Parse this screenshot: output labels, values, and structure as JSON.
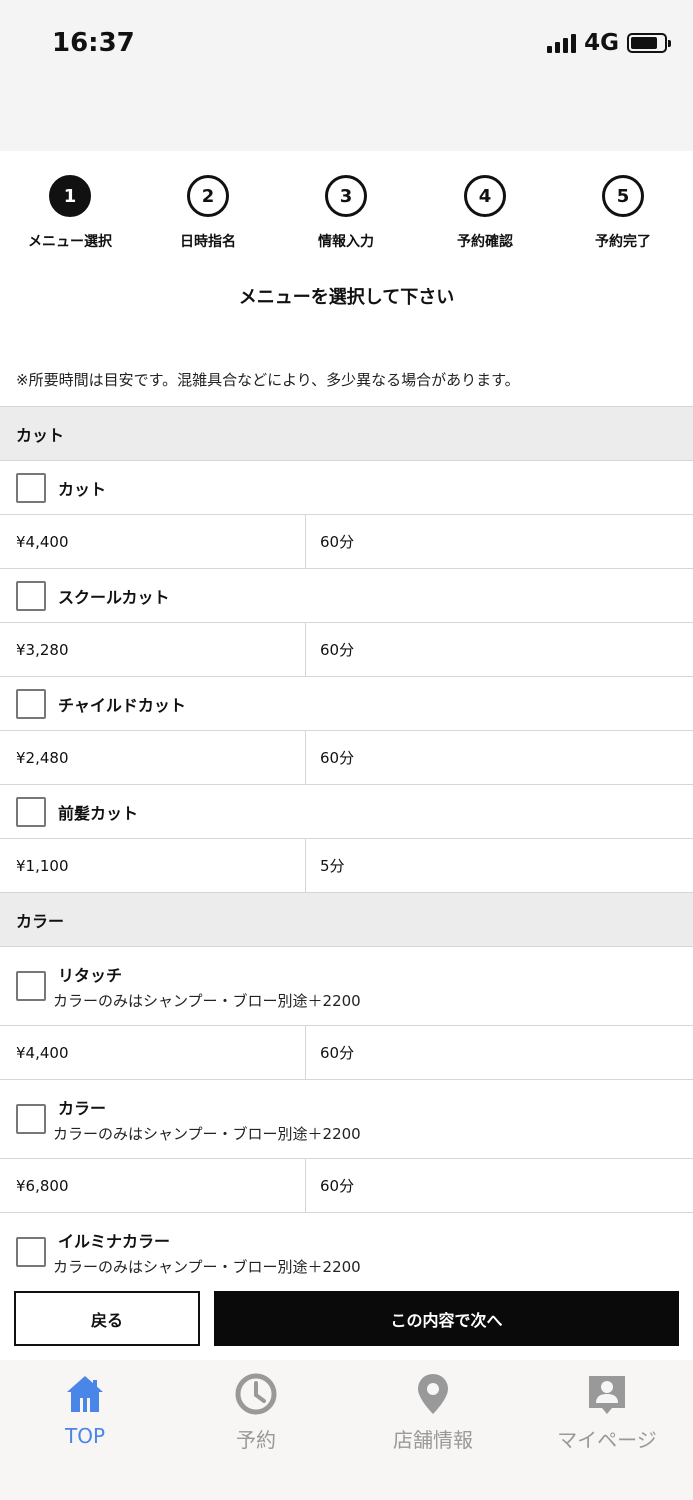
{
  "status_bar": {
    "time": "16:37",
    "network": "4G"
  },
  "steps": [
    {
      "number": "1",
      "label": "メニュー選択"
    },
    {
      "number": "2",
      "label": "日時指名"
    },
    {
      "number": "3",
      "label": "情報入力"
    },
    {
      "number": "4",
      "label": "予約確認"
    },
    {
      "number": "5",
      "label": "予約完了"
    }
  ],
  "active_step": 1,
  "heading": "メニューを選択して下さい",
  "notice": "※所要時間は目安です。混雑具合などにより、多少異なる場合があります。",
  "categories": [
    {
      "name": "カット",
      "items": [
        {
          "name": "カット",
          "price": "¥4,400",
          "duration": "60分"
        },
        {
          "name": "スクールカット",
          "price": "¥3,280",
          "duration": "60分"
        },
        {
          "name": "チャイルドカット",
          "price": "¥2,480",
          "duration": "60分"
        },
        {
          "name": "前髪カット",
          "price": "¥1,100",
          "duration": "5分"
        }
      ]
    },
    {
      "name": "カラー",
      "items": [
        {
          "name": "リタッチ",
          "note": "カラーのみはシャンプー・ブロー別途＋2200",
          "price": "¥4,400",
          "duration": "60分"
        },
        {
          "name": "カラー",
          "note": "カラーのみはシャンプー・ブロー別途＋2200",
          "price": "¥6,800",
          "duration": "60分"
        },
        {
          "name": "イルミナカラー",
          "note": "カラーのみはシャンプー・ブロー別途＋2200"
        }
      ]
    }
  ],
  "buttons": {
    "back": "戻る",
    "next": "この内容で次へ"
  },
  "tabbar": [
    {
      "label": "TOP",
      "icon": "home-icon"
    },
    {
      "label": "予約",
      "icon": "clock-icon"
    },
    {
      "label": "店舗情報",
      "icon": "map-pin-icon"
    },
    {
      "label": "マイページ",
      "icon": "profile-icon"
    }
  ],
  "colors": {
    "active_tab": "#4a86e8",
    "inactive_tab": "#999999",
    "primary_button": "#0a0a0a"
  }
}
